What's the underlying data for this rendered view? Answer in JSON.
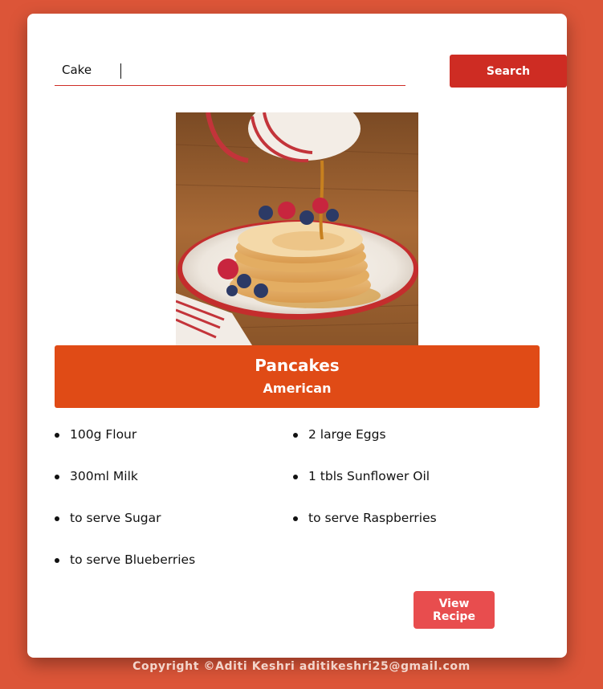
{
  "search": {
    "value": "Cake",
    "button_label": "Search"
  },
  "recipe": {
    "name": "Pancakes",
    "area": "American",
    "ingredients": [
      "100g Flour",
      "2 large Eggs",
      "300ml Milk",
      "1 tbls Sunflower Oil",
      "to serve Sugar",
      "to serve Raspberries",
      "to serve Blueberries"
    ],
    "view_button_label": "View Recipe"
  },
  "footer": {
    "text": "Copyright ©Aditi Keshri aditikeshri25@gmail.com"
  },
  "colors": {
    "background": "#dc5538",
    "search_button": "#ce2c23",
    "title_banner": "#e04b16",
    "view_button": "#e84d4e"
  }
}
